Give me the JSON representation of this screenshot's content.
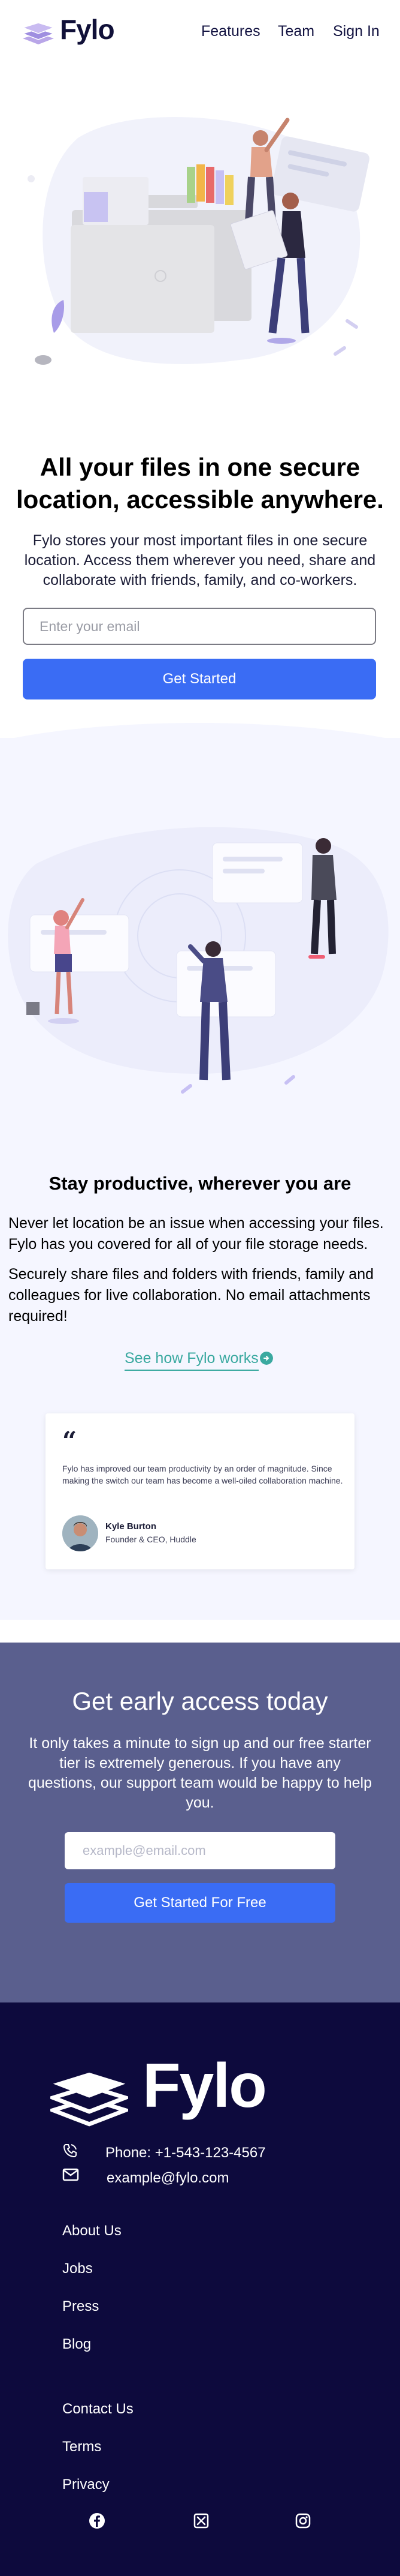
{
  "brand": {
    "name": "Fylo"
  },
  "nav": {
    "items": [
      "Features",
      "Team",
      "Sign In"
    ]
  },
  "hero": {
    "title": "All your files in one secure location, accessible anywhere.",
    "description": "Fylo stores your most important files in one secure location. Access them wherever you need, share and collaborate with friends, family, and co-workers.",
    "email_placeholder": "Enter your email",
    "cta": "Get Started"
  },
  "productive": {
    "title": "Stay productive, wherever you are",
    "p1": "Never let location be an issue when accessing your files. Fylo has you covered for all of your file storage needs.",
    "p2": "Securely share files and folders with friends, family and colleagues for live collaboration. No email attachments required!",
    "link": "See how Fylo works"
  },
  "testimonial": {
    "quote": "Fylo has improved our team productivity by an order of magnitude. Since making the switch our team has become a well-oiled collaboration machine.",
    "name": "Kyle Burton",
    "role": "Founder & CEO, Huddle"
  },
  "early_access": {
    "title": "Get early access today",
    "description": "It only takes a minute to sign up and our free starter tier is extremely generous. If you have any questions, our support team would be happy to help you.",
    "email_placeholder": "example@email.com",
    "cta": "Get Started For Free"
  },
  "footer": {
    "phone": "Phone: +1-543-123-4567",
    "email": "example@fylo.com",
    "links_a": [
      "About Us",
      "Jobs",
      "Press",
      "Blog"
    ],
    "links_b": [
      "Contact Us",
      "Terms",
      "Privacy"
    ],
    "socials": [
      "facebook-icon",
      "x-icon",
      "instagram-icon"
    ]
  },
  "colors": {
    "accent": "#3a6cf4",
    "teal": "#3aa9a0",
    "early_bg": "#5a5f8e",
    "footer_bg": "#0d0a3d"
  }
}
